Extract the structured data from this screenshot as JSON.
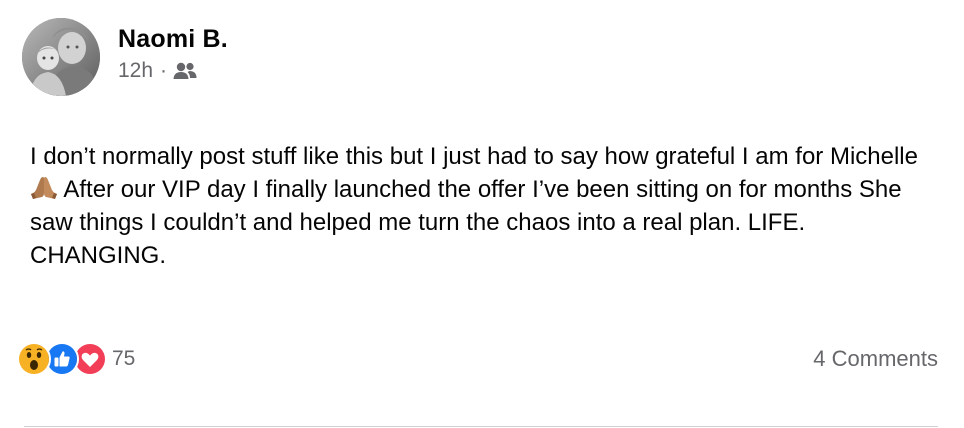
{
  "post": {
    "author": "Naomi B.",
    "time": "12h",
    "separator": "·",
    "audience_icon": "friends-icon",
    "text_part1": "I don’t normally post stuff like this but I just had to say how grateful I am for Michelle",
    "emoji_icon": "folded-hands-icon",
    "text_part2": "After our VIP day I finally launched the offer I’ve been sitting on for months She saw things I couldn’t and helped me turn the chaos into a real plan. LIFE. CHANGING."
  },
  "footer": {
    "reaction_icons": [
      "wow-icon",
      "like-icon",
      "love-icon"
    ],
    "reaction_count": "75",
    "comments_label": "4 Comments"
  },
  "colors": {
    "text": "#050505",
    "secondary": "#65676b",
    "like_blue": "#1877f2",
    "love_red": "#f33e58",
    "wow_yellow": "#f7b125",
    "divider": "#ced0d4"
  }
}
